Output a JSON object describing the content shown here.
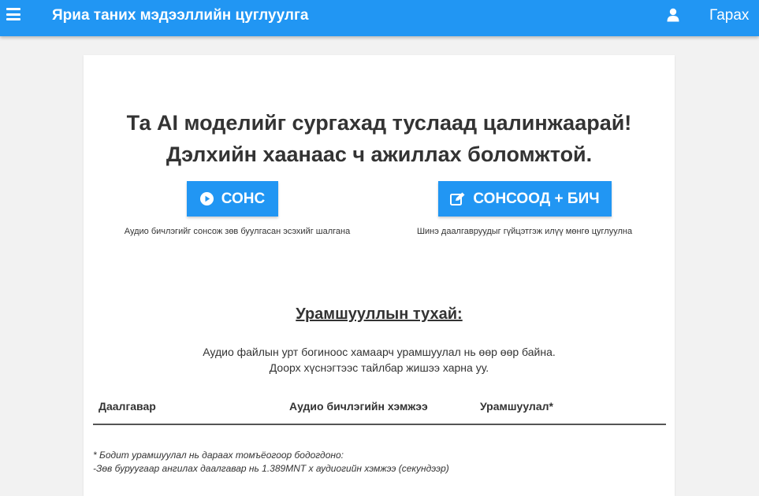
{
  "header": {
    "title": "Яриа таних мэдээллийн цуглуулга",
    "logout_label": "Гарах"
  },
  "main": {
    "headline_line1": "Та AI моделийг сургахад туслаад цалинжаарай!",
    "headline_line2": "Дэлхийн хаанаас ч ажиллах боломжтой.",
    "listen_button": "СОНС",
    "listen_caption": "Аудио бичлэгийг сонсож зөв буулгасан эсэхийг шалгана",
    "write_button": "СОНСООД + БИЧ",
    "write_caption": "Шинэ даалгавруудыг гүйцэтгэж илүү мөнгө цуглуулна",
    "bonus_title": "Урамшууллын тухай:",
    "bonus_desc_line1": "Аудио файлын урт богиноос хамаарч урамшуулал нь өөр өөр байна.",
    "bonus_desc_line2": "Доорх хүснэгтээс тайлбар жишээ харна уу.",
    "table_headers": [
      "Даалгавар",
      "Аудио бичлэгийн хэмжээ",
      "Урамшуулал*"
    ],
    "note_line1": "* Бодит урамшуулал нь дараах томъёогоор бодогдоно:",
    "note_line2": "-Зөв буруугаар ангилах даалгавар нь 1.389MNT x аудиогийн хэмжээ (секундээр)"
  },
  "colors": {
    "primary": "#2196f3",
    "background": "#f2f2f2",
    "text": "#333333"
  },
  "icons": {
    "menu": "hamburger-icon",
    "user": "user-icon",
    "listen": "play-circle-icon",
    "write": "edit-icon"
  }
}
